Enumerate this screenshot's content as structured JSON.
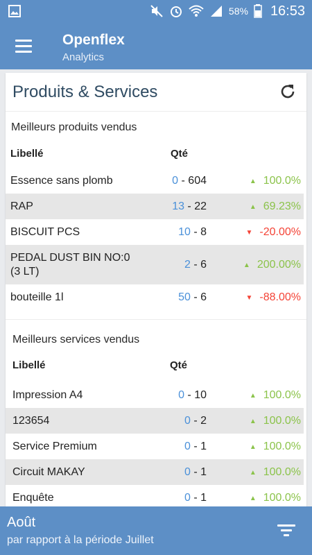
{
  "status_bar": {
    "battery": "58%",
    "time": "16:53",
    "icons": [
      "gallery-icon",
      "mute-icon",
      "alarm-icon",
      "wifi-icon",
      "signal-icon",
      "battery-icon"
    ]
  },
  "app_bar": {
    "title": "Openflex",
    "subtitle": "Analytics",
    "menu_icon": "hamburger-menu-icon"
  },
  "card": {
    "title": "Produits & Services",
    "refresh_icon": "refresh-icon"
  },
  "products": {
    "title": "Meilleurs produits vendus",
    "col_label": "Libellé",
    "col_qty": "Qté",
    "rows": [
      {
        "label": "Essence sans plomb",
        "prev": "0",
        "sep": " - ",
        "curr": "604",
        "pct": "100.0%",
        "trend": "up"
      },
      {
        "label": "RAP",
        "prev": "13",
        "sep": " - ",
        "curr": "22",
        "pct": "69.23%",
        "trend": "up"
      },
      {
        "label": "BISCUIT PCS",
        "prev": "10",
        "sep": " - ",
        "curr": "8",
        "pct": "-20.00%",
        "trend": "down"
      },
      {
        "label": "PEDAL DUST BIN NO:0 (3 LT)",
        "prev": "2",
        "sep": " - ",
        "curr": "6",
        "pct": "200.00%",
        "trend": "up"
      },
      {
        "label": "bouteille 1l",
        "prev": "50",
        "sep": " - ",
        "curr": "6",
        "pct": "-88.00%",
        "trend": "down"
      }
    ]
  },
  "services": {
    "title": "Meilleurs services vendus",
    "col_label": "Libellé",
    "col_qty": "Qté",
    "rows": [
      {
        "label": "Impression A4",
        "prev": "0",
        "sep": " - ",
        "curr": "10",
        "pct": "100.0%",
        "trend": "up"
      },
      {
        "label": "123654",
        "prev": "0",
        "sep": " - ",
        "curr": "2",
        "pct": "100.0%",
        "trend": "up"
      },
      {
        "label": "Service Premium",
        "prev": "0",
        "sep": " - ",
        "curr": "1",
        "pct": "100.0%",
        "trend": "up"
      },
      {
        "label": "Circuit MAKAY",
        "prev": "0",
        "sep": " - ",
        "curr": "1",
        "pct": "100.0%",
        "trend": "up"
      },
      {
        "label": "Enquête",
        "prev": "0",
        "sep": " - ",
        "curr": "1",
        "pct": "100.0%",
        "trend": "up"
      }
    ]
  },
  "bottom_bar": {
    "month": "Août",
    "comparison": "par rapport à la période Juillet",
    "filter_icon": "filter-icon"
  },
  "colors": {
    "primary": "#5d8fc6",
    "trend_up": "#8bc34a",
    "trend_down": "#f44336",
    "qty_prev": "#4a90d9"
  }
}
